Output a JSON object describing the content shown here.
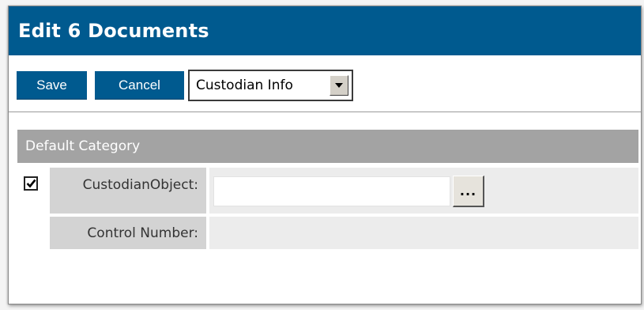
{
  "dialog": {
    "title": "Edit 6 Documents"
  },
  "toolbar": {
    "save_label": "Save",
    "cancel_label": "Cancel",
    "layout_select": {
      "selected": "Custodian Info"
    }
  },
  "category": {
    "title": "Default Category"
  },
  "fields": [
    {
      "label": "CustodianObject:",
      "checked": true,
      "value": "",
      "picker_label": "..."
    },
    {
      "label": "Control Number:",
      "value": ""
    }
  ],
  "colors": {
    "header_blue": "#005a8f",
    "category_gray": "#a3a3a3",
    "label_gray": "#d3d3d3",
    "value_gray": "#ececec"
  }
}
